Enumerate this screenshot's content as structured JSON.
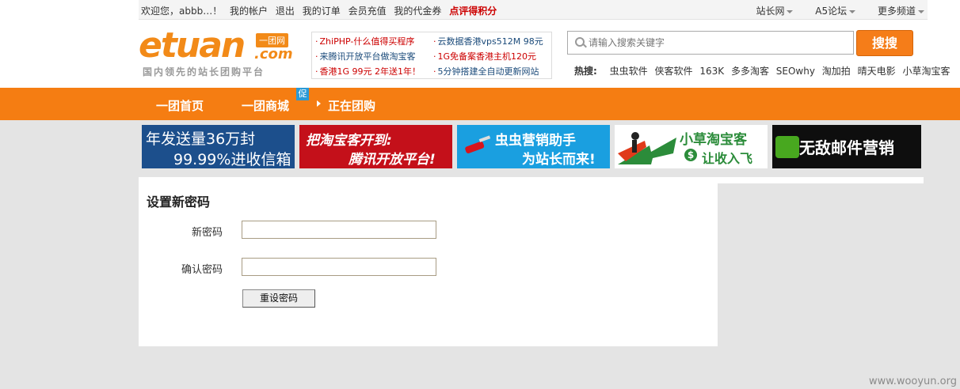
{
  "topbar": {
    "links": [
      "欢迎您，abbb…！",
      "我的帐户",
      "退出",
      "我的订单",
      "会员充值",
      "我的代金券"
    ],
    "highlight": "点评得积分",
    "right_menus": [
      "站长网",
      "A5论坛",
      "更多频道"
    ]
  },
  "logo": {
    "word": "etuan",
    "com": ".com",
    "badge": "一团网",
    "slogan": "国内领先的站长团购平台"
  },
  "promo": {
    "left": [
      "ZhiPHP-什么值得买程序",
      "来腾讯开放平台做淘宝客",
      "香港1G 99元 2年送1年！"
    ],
    "right": [
      "云数据香港vps512M 98元",
      "1G免备案香港主机120元",
      "5分钟搭建全自动更新网站"
    ]
  },
  "search": {
    "placeholder": "请输入搜索关键字",
    "button": "搜搜"
  },
  "hot": {
    "label": "热搜:",
    "items": [
      "虫虫软件",
      "侠客软件",
      "163K",
      "多多淘客",
      "SEOwhy",
      "淘加拍",
      "晴天电影",
      "小草淘宝客"
    ]
  },
  "nav": {
    "items": [
      "一团首页",
      "一团商城",
      "正在团购"
    ],
    "tag": "促"
  },
  "banners": [
    {
      "line1": "年发送量36万封",
      "line2": "99.99%进收信箱"
    },
    {
      "line1": "把淘宝客开到:",
      "line2": "腾讯开放平台!"
    },
    {
      "line1": "虫虫营销助手",
      "line2": "为站长而来!"
    },
    {
      "line1": "小草淘宝客",
      "line2": "让收入飞"
    },
    {
      "line1": "无敌邮件营销"
    }
  ],
  "form": {
    "title": "设置新密码",
    "new_password_label": "新密码",
    "confirm_password_label": "确认密码",
    "submit": "重设密码"
  },
  "watermark": "www.wooyun.org"
}
